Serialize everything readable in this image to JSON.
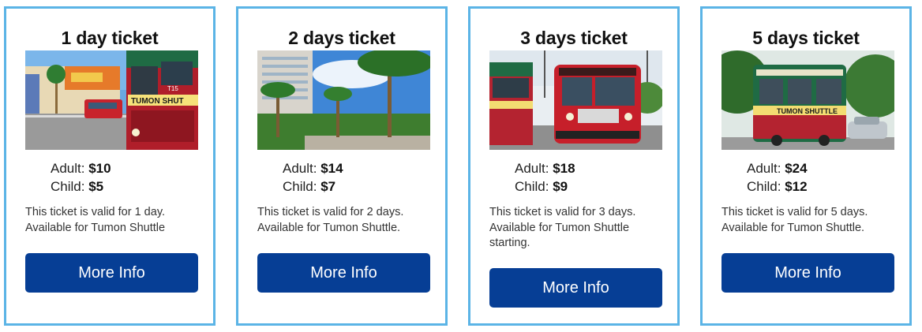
{
  "tickets": [
    {
      "title": "1 day ticket",
      "adult_label": "Adult:",
      "adult_price": "$10",
      "child_label": "Child:",
      "child_price": "$5",
      "desc_line1": "This ticket is valid for 1 day.",
      "desc_line2": "Available for Tumon Shuttle",
      "desc_line3": "",
      "button": "More Info",
      "photo_signs": {
        "bus_number": "T15",
        "bus_banner": "TUMON SHUT"
      }
    },
    {
      "title": "2 days ticket",
      "adult_label": "Adult:",
      "adult_price": "$14",
      "child_label": "Child:",
      "child_price": "$7",
      "desc_line1": "This ticket is valid for 2 days.",
      "desc_line2": "Available for Tumon Shuttle.",
      "desc_line3": "",
      "button": "More Info"
    },
    {
      "title": "3 days ticket",
      "adult_label": "Adult:",
      "adult_price": "$18",
      "child_label": "Child:",
      "child_price": "$9",
      "desc_line1": "This ticket is valid for 3 days.",
      "desc_line2": "Available for Tumon Shuttle",
      "desc_line3": "starting.",
      "button": "More Info"
    },
    {
      "title": "5 days ticket",
      "adult_label": "Adult:",
      "adult_price": "$24",
      "child_label": "Child:",
      "child_price": "$12",
      "desc_line1": "This ticket is valid for 5 days.",
      "desc_line2": "Available for Tumon Shuttle.",
      "desc_line3": "",
      "button": "More Info",
      "photo_signs": {
        "bus_banner": "TUMON SHUTTLE"
      }
    }
  ],
  "colors": {
    "card_border": "#5bb4e6",
    "button_bg": "#063e95",
    "button_text": "#ffffff"
  }
}
